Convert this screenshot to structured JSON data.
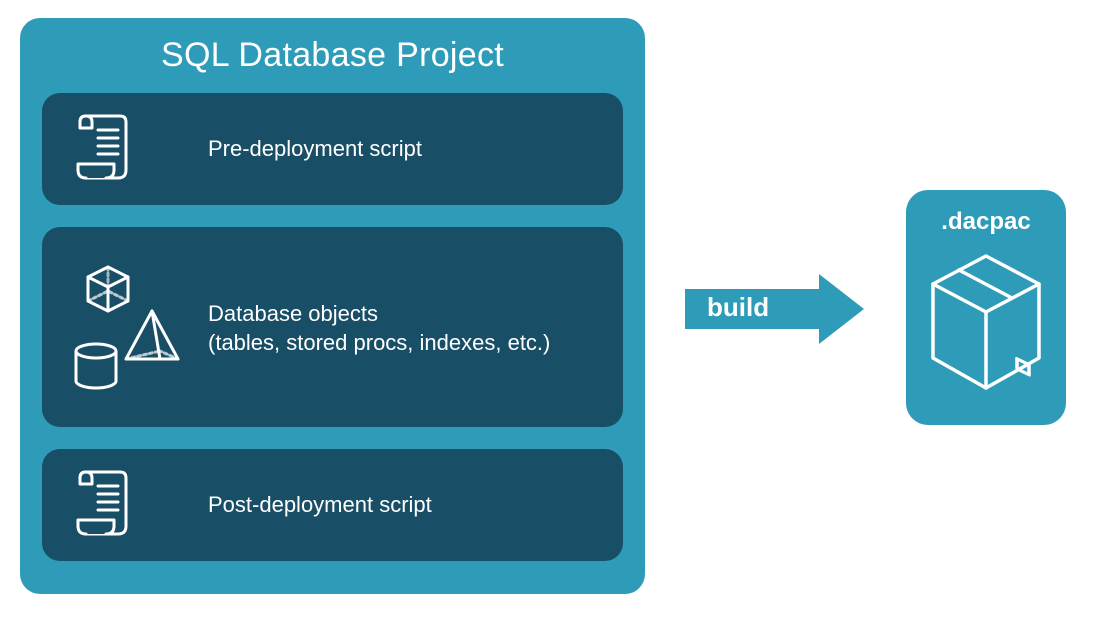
{
  "project": {
    "title": "SQL Database Project",
    "items": [
      {
        "label": "Pre-deployment script"
      },
      {
        "label": "Database objects",
        "sub": "(tables, stored procs, indexes, etc.)"
      },
      {
        "label": "Post-deployment script"
      }
    ]
  },
  "arrow": {
    "label": "build"
  },
  "output": {
    "label": ".dacpac"
  },
  "colors": {
    "teal": "#2E9CB8",
    "darkblue": "#184E66",
    "white": "#ffffff"
  }
}
